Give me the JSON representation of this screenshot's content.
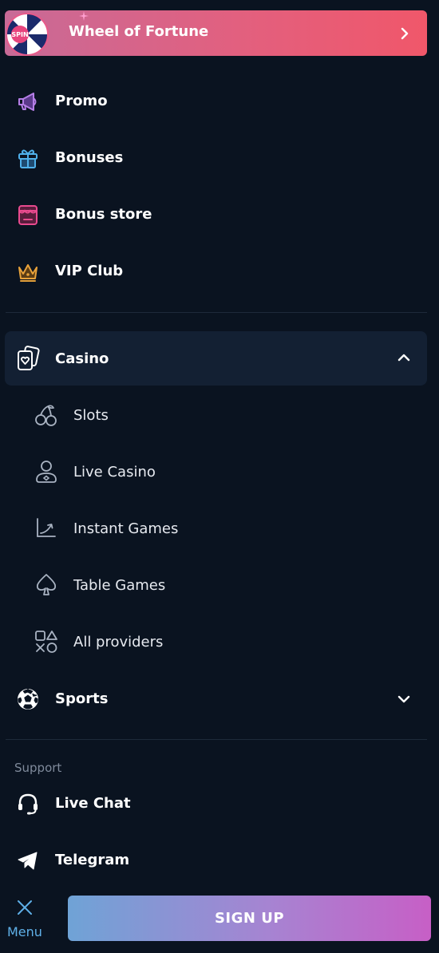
{
  "banner": {
    "title": "Wheel of Fortune",
    "wheel_text": "SPIN"
  },
  "menu": {
    "items": [
      {
        "label": "Promo",
        "icon": "megaphone-icon"
      },
      {
        "label": "Bonuses",
        "icon": "gift-icon"
      },
      {
        "label": "Bonus store",
        "icon": "store-icon"
      },
      {
        "label": "VIP Club",
        "icon": "crown-icon"
      }
    ]
  },
  "casino": {
    "label": "Casino",
    "expanded": true,
    "sub_items": [
      {
        "label": "Slots",
        "icon": "cherries-icon"
      },
      {
        "label": "Live Casino",
        "icon": "dealer-icon"
      },
      {
        "label": "Instant Games",
        "icon": "crash-graph-icon"
      },
      {
        "label": "Table Games",
        "icon": "spade-icon"
      },
      {
        "label": "All providers",
        "icon": "shapes-icon"
      }
    ]
  },
  "sports": {
    "label": "Sports",
    "expanded": false
  },
  "support": {
    "heading": "Support",
    "items": [
      {
        "label": "Live Chat",
        "icon": "headset-icon"
      },
      {
        "label": "Telegram",
        "icon": "telegram-icon"
      }
    ]
  },
  "bottom_bar": {
    "menu_label": "Menu",
    "signup_label": "SIGN UP"
  },
  "colors": {
    "background": "#0a1320",
    "banner_gradient_start": "#c86a97",
    "banner_gradient_end": "#f0576a",
    "signup_gradient_start": "#6fa3d6",
    "signup_gradient_end": "#c75fc6",
    "promo_icon": "#b57ee6",
    "bonuses_icon": "#4fb0ea",
    "store_icon": "#e84a8e",
    "vip_icon": "#e8a23a",
    "active_row": "#132033",
    "menu_label": "#5fb0e8"
  }
}
